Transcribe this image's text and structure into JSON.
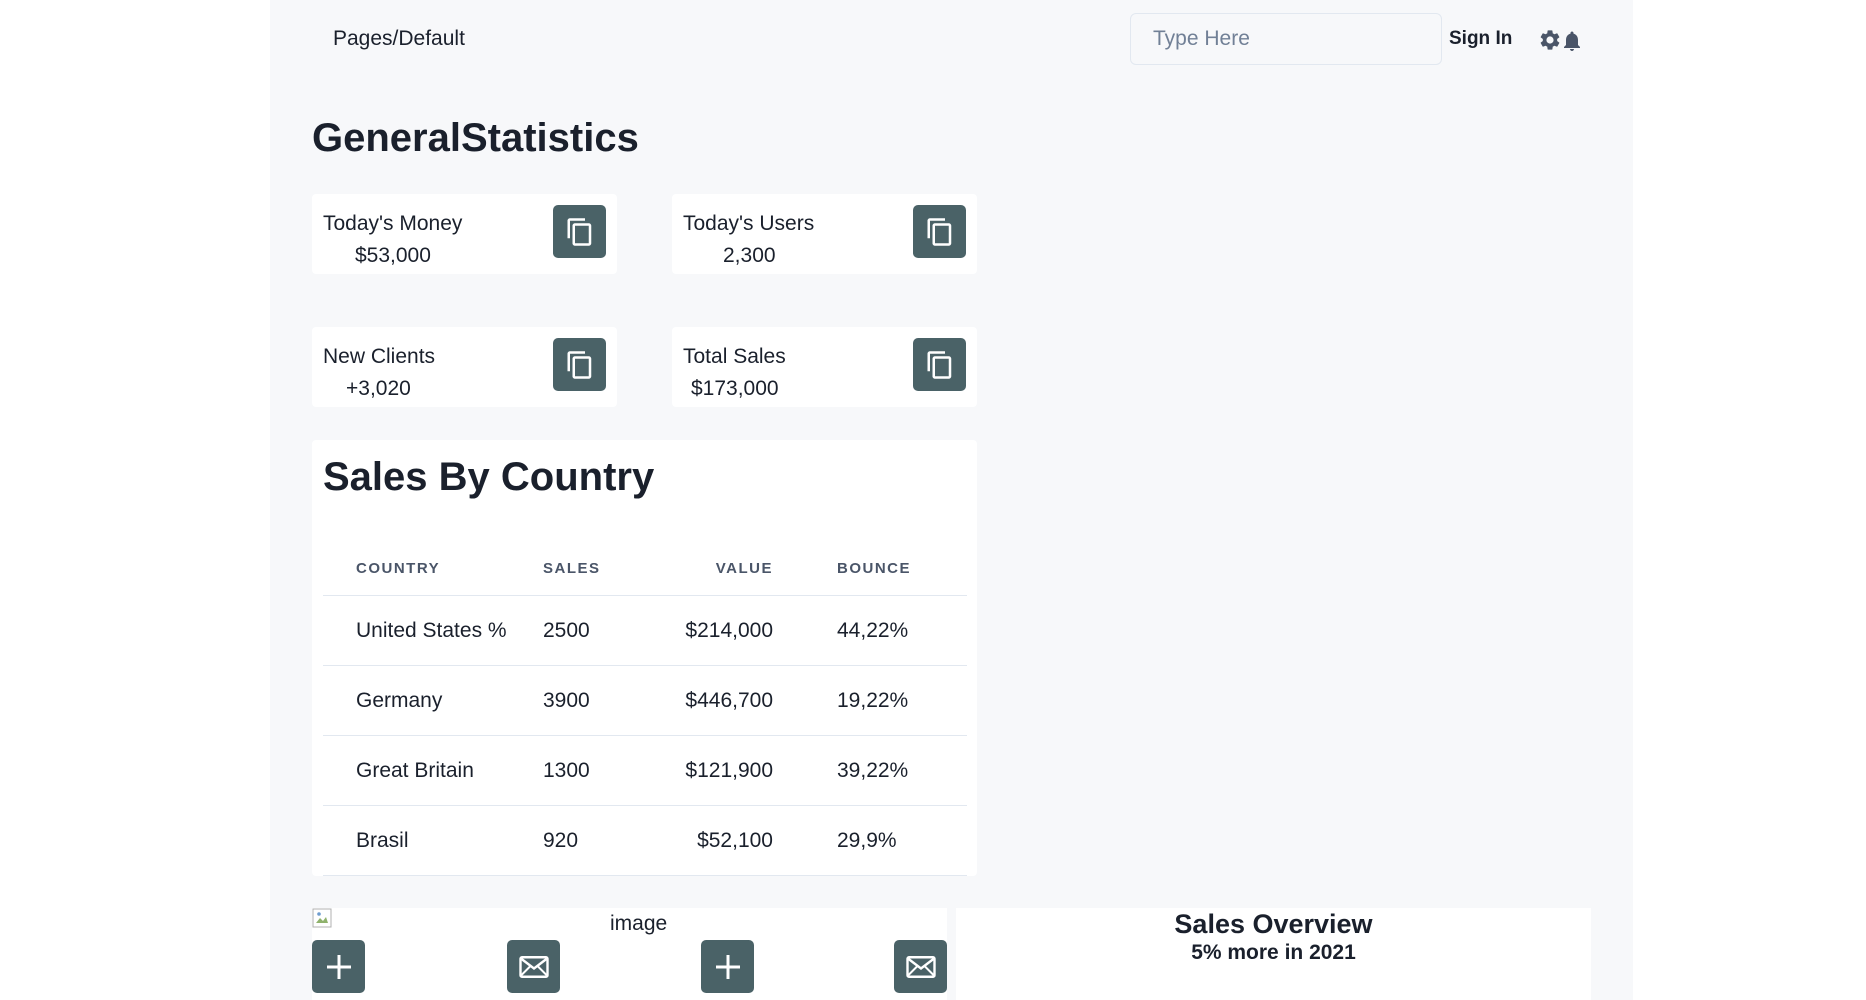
{
  "header": {
    "breadcrumb": "Pages/Default",
    "search_placeholder": "Type Here",
    "sign_in": "Sign In",
    "icons": [
      "gear-icon",
      "bell-icon"
    ]
  },
  "page_title": "GeneralStatistics",
  "stats": [
    {
      "label": "Today's Money",
      "value": "$53,000",
      "icon": "copy-icon"
    },
    {
      "label": "Today's Users",
      "value": "2,300",
      "icon": "copy-icon"
    },
    {
      "label": "New Clients",
      "value": "+3,020",
      "icon": "copy-icon"
    },
    {
      "label": "Total Sales",
      "value": "$173,000",
      "icon": "copy-icon"
    }
  ],
  "sales_by_country": {
    "title": "Sales By Country",
    "columns": [
      "COUNTRY",
      "SALES",
      "VALUE",
      "BOUNCE"
    ],
    "rows": [
      {
        "country": "United States %",
        "sales": "2500",
        "value": "$214,000",
        "bounce": "44,22%"
      },
      {
        "country": "Germany",
        "sales": "3900",
        "value": "$446,700",
        "bounce": "19,22%"
      },
      {
        "country": "Great Britain",
        "sales": "1300",
        "value": "$121,900",
        "bounce": "39,22%"
      },
      {
        "country": "Brasil",
        "sales": "920",
        "value": "$52,100",
        "bounce": "29,9%"
      }
    ]
  },
  "image_strip": {
    "alt_text": "image",
    "buttons": [
      "plus-icon",
      "mail-icon",
      "plus-icon",
      "mail-icon"
    ]
  },
  "sales_overview": {
    "title": "Sales Overview",
    "subtitle": "5% more in 2021"
  },
  "colors": {
    "accent": "#4a6267",
    "page_background": "#f7f8fa",
    "card_background": "#ffffff",
    "text": "#1a202c"
  }
}
